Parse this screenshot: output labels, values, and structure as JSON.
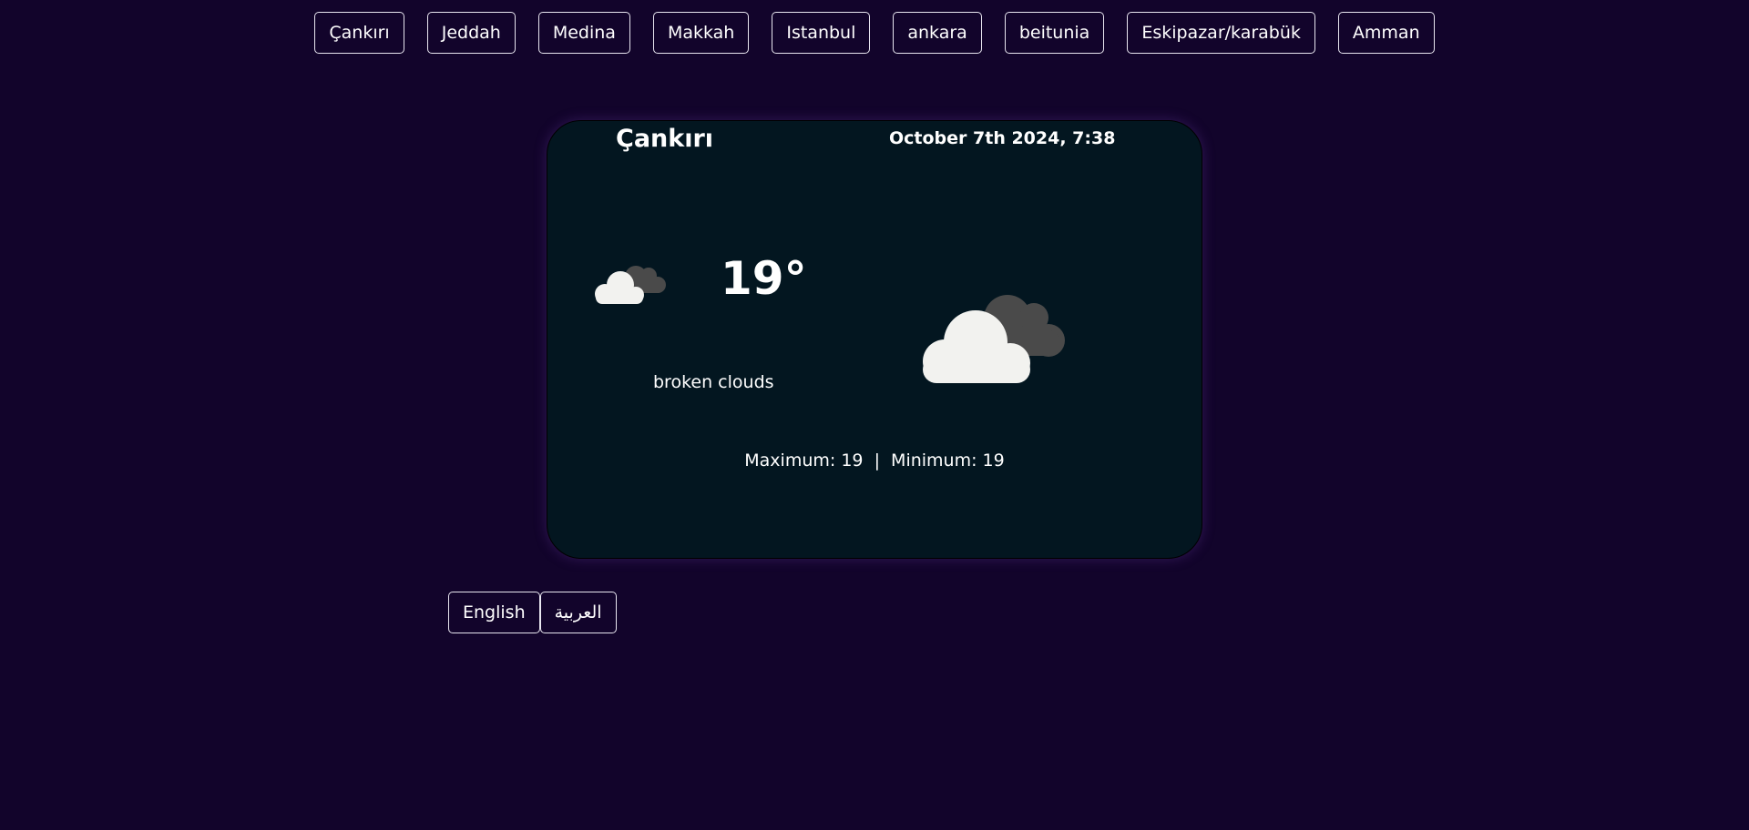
{
  "cities": [
    "Çankırı",
    "Jeddah",
    "Medina",
    "Makkah",
    "Istanbul",
    "ankara",
    "beitunia",
    "Eskipazar/karabük",
    "Amman"
  ],
  "weather": {
    "city": "Çankırı",
    "datetime": "October 7th 2024, 7:38",
    "temperature": "19°",
    "description": "broken clouds",
    "icon": "broken-clouds-icon",
    "max_min": "Maximum: 19  |  Minimum: 19"
  },
  "languages": [
    "English",
    "العربية"
  ],
  "colors": {
    "background": "#12042b",
    "card": "#031620",
    "text": "#ffffff",
    "cloud_light": "#f2f2ef",
    "cloud_dark": "#4a4a4a"
  }
}
